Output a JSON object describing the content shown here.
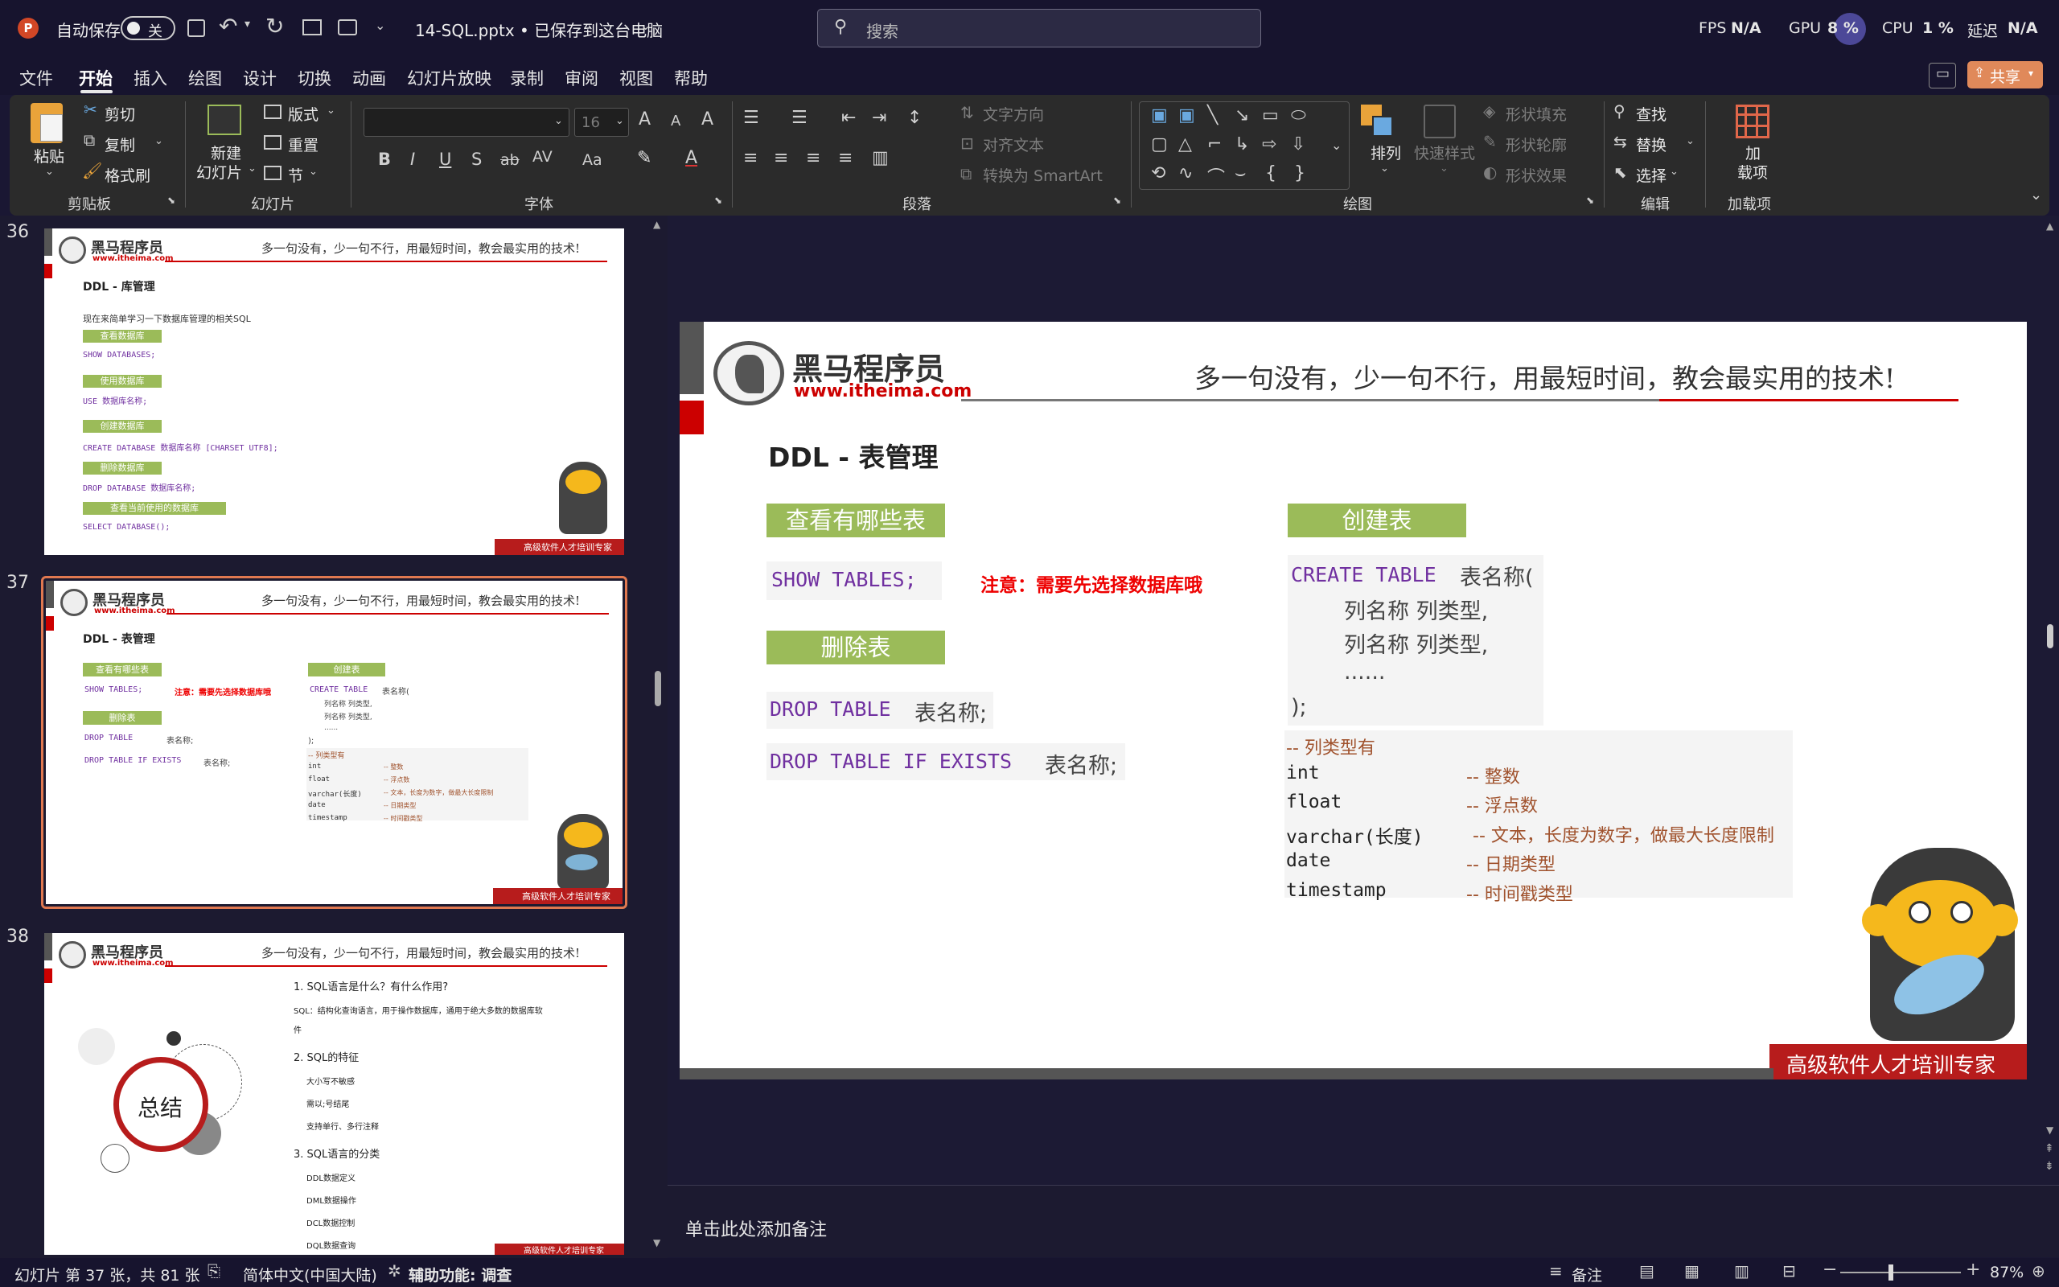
{
  "titlebar": {
    "autosave": "自动保存",
    "autosave_state": "关",
    "filename": "14-SQL.pptx • 已保存到这台电脑",
    "search_placeholder": "搜索",
    "fps_label": "FPS",
    "fps_value": "N/A",
    "gpu_label": "GPU",
    "gpu_value": "8 %",
    "cpu_label": "CPU",
    "cpu_value": "1 %",
    "delay_label": "延迟",
    "delay_value": "N/A"
  },
  "menu": {
    "items": [
      "文件",
      "开始",
      "插入",
      "绘图",
      "设计",
      "切换",
      "动画",
      "幻灯片放映",
      "录制",
      "审阅",
      "视图",
      "帮助"
    ],
    "share": "共享"
  },
  "ribbon": {
    "clipboard": {
      "paste": "粘贴",
      "cut": "剪切",
      "copy": "复制",
      "format_painter": "格式刷",
      "group": "剪贴板"
    },
    "slides": {
      "new_slide_1": "新建",
      "new_slide_2": "幻灯片",
      "layout": "版式",
      "reset": "重置",
      "section": "节",
      "group": "幻灯片"
    },
    "font": {
      "font_size": "16",
      "group": "字体"
    },
    "paragraph": {
      "text_direction": "文字方向",
      "align_text": "对齐文本",
      "smartart": "转换为 SmartArt",
      "group": "段落"
    },
    "drawing": {
      "arrange": "排列",
      "quick_styles": "快速样式",
      "shape_fill": "形状填充",
      "shape_outline": "形状轮廓",
      "shape_effects": "形状效果",
      "group": "绘图"
    },
    "editing": {
      "find": "查找",
      "replace": "替换",
      "select": "选择",
      "group": "编辑"
    },
    "addins": {
      "label1": "加",
      "label2": "载项",
      "group": "加载项"
    }
  },
  "slide_common": {
    "brand": "黑马程序员",
    "brand_url": "www.itheima.com",
    "slogan": "多一句没有，少一句不行，用最短时间，教会最实用的技术!",
    "footer": "高级软件人才培训专家"
  },
  "thumbnails": [
    {
      "number": "36",
      "title": "DDL - 库管理",
      "intro": "现在来简单学习一下数据库管理的相关SQL",
      "items": [
        {
          "label": "查看数据库",
          "code": "SHOW DATABASES;"
        },
        {
          "label": "使用数据库",
          "code": "USE 数据库名称;"
        },
        {
          "label": "创建数据库",
          "code": "CREATE DATABASE 数据库名称 [CHARSET UTF8];"
        },
        {
          "label": "删除数据库",
          "code": "DROP DATABASE 数据库名称;"
        },
        {
          "label": "查看当前使用的数据库",
          "code": "SELECT DATABASE();"
        }
      ]
    },
    {
      "number": "37"
    },
    {
      "number": "38",
      "center": "总结",
      "lines": [
        "1. SQL语言是什么？有什么作用?",
        "SQL：结构化查询语言，用于操作数据库，通用于绝大多数的数据库软",
        "件",
        "2. SQL的特征",
        "大小写不敏感",
        "需以;号结尾",
        "支持单行、多行注释",
        "3. SQL语言的分类",
        "DDL数据定义",
        "DML数据操作",
        "DCL数据控制",
        "DQL数据查询"
      ]
    }
  ],
  "slide": {
    "title": "DDL - 表管理",
    "show_tables_label": "查看有哪些表",
    "show_tables_code": "SHOW TABLES;",
    "note": "注意：需要先选择数据库哦",
    "drop_label": "删除表",
    "drop_code_kw": "DROP TABLE",
    "drop_code_rest": "表名称;",
    "drop_if_kw": "DROP TABLE IF EXISTS",
    "drop_if_rest": "表名称;",
    "create_label": "创建表",
    "create_kw": "CREATE TABLE",
    "create_name": "表名称(",
    "col_line": "列名称 列类型,",
    "dots": "......",
    "close": ");",
    "types_comment": "-- 列类型有",
    "types": [
      {
        "name": "int",
        "desc": "-- 整数"
      },
      {
        "name": "float",
        "desc": "-- 浮点数"
      },
      {
        "name": "varchar(长度)",
        "desc": "-- 文本，长度为数字，做最大长度限制"
      },
      {
        "name": "date",
        "desc": "-- 日期类型"
      },
      {
        "name": "timestamp",
        "desc": "-- 时间戳类型"
      }
    ]
  },
  "notes_placeholder": "单击此处添加备注",
  "status": {
    "slide_info": "幻灯片 第 37 张，共 81 张",
    "language": "简体中文(中国大陆)",
    "accessibility": "辅助功能: 调查",
    "notes": "备注",
    "zoom": "87%"
  }
}
